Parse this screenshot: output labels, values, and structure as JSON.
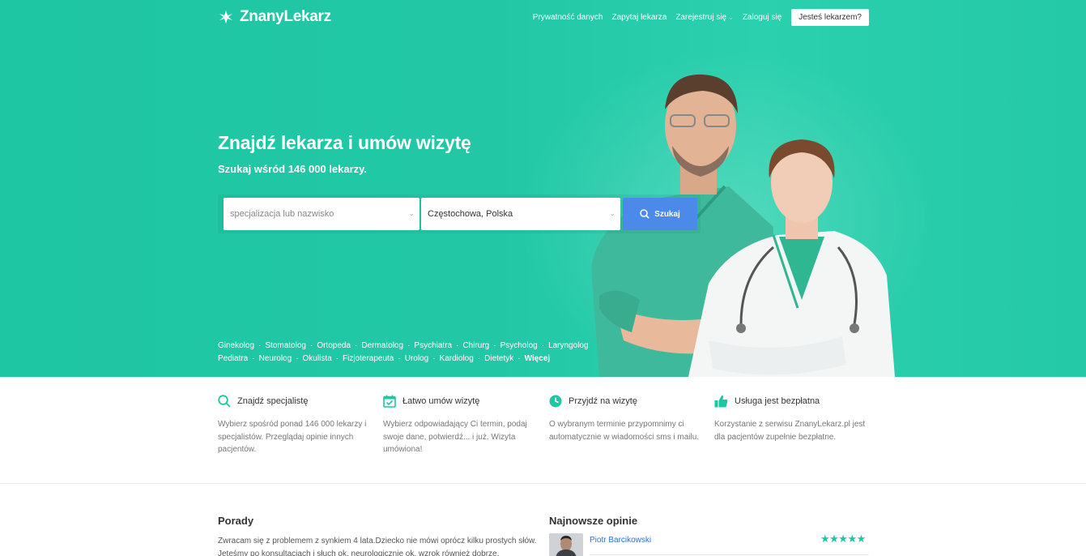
{
  "brand": {
    "name": "ZnanyLekarz",
    "accent": "#1fc6a4",
    "button_blue": "#4b8ae8"
  },
  "nav": {
    "links": [
      "Prywatność danych",
      "Zapytaj lekarza",
      "Zarejestruj się",
      "Zaloguj się"
    ],
    "doctor_button": "Jesteś lekarzem?"
  },
  "hero": {
    "title": "Znajdź lekarza i umów wizytę",
    "subtitle": "Szukaj wśród 146 000 lekarzy."
  },
  "search": {
    "specialty_placeholder": "specjalizacja lub nazwisko",
    "location_value": "Częstochowa, Polska",
    "button_label": "Szukaj"
  },
  "specialties": {
    "row1": [
      "Ginekolog",
      "Stomatolog",
      "Ortopeda",
      "Dermatolog",
      "Psychiatra",
      "Chirurg",
      "Psycholog",
      "Laryngolog"
    ],
    "row2": [
      "Pediatra",
      "Neurolog",
      "Okulista",
      "Fizjoterapeuta",
      "Urolog",
      "Kardiolog",
      "Dietetyk"
    ],
    "more": "Więcej",
    "separator": "·"
  },
  "features": [
    {
      "icon": "search-icon",
      "title": "Znajdź specjalistę",
      "desc": "Wybierz spośród ponad 146 000 lekarzy i specjalistów. Przeglądaj opinie innych pacjentów."
    },
    {
      "icon": "calendar-check-icon",
      "title": "Łatwo umów wizytę",
      "desc": "Wybierz odpowiadający Ci termin, podaj swoje dane, potwierdź... i już. Wizyta umówiona!"
    },
    {
      "icon": "clock-icon",
      "title": "Przyjdź na wizytę",
      "desc": "O wybranym terminie przypomnimy ci automatycznie w wiadomości sms i mailu."
    },
    {
      "icon": "thumbs-up-icon",
      "title": "Usługa jest bezpłatna",
      "desc": "Korzystanie z serwisu ZnanyLekarz.pl jest dla pacjentów zupełnie bezpłatne."
    }
  ],
  "porady": {
    "title": "Porady",
    "text": "Zwracam się z problemem z synkiem 4 lata.Dziecko nie mówi oprócz kilku prostych słów. Jeteśmy po konsultacjach i słuch ok, neurologicznie ok, wzrok również dobrze."
  },
  "opinions": {
    "title": "Najnowsze opinie",
    "first_name": "Piotr Barcikowski",
    "stars": "★★★★★",
    "rating": 5
  }
}
